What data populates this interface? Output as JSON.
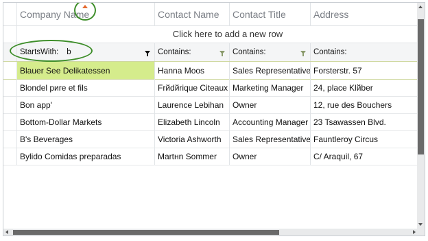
{
  "columns": [
    "Company Name",
    "Contact Name",
    "Contact Title",
    "Address"
  ],
  "new_row_text": "Click here to add a new row",
  "filter": [
    {
      "operator": "StartsWith:",
      "value": "b"
    },
    {
      "operator": "Contains:",
      "value": ""
    },
    {
      "operator": "Contains:",
      "value": ""
    },
    {
      "operator": "Contains:",
      "value": ""
    }
  ],
  "rows": [
    [
      "Blauer See Delikatessen",
      "Hanna Moos",
      "Sales Representative",
      "Forsterstr. 57"
    ],
    [
      "Blondel pиre et fils",
      "Frйdйrique Citeaux",
      "Marketing Manager",
      "24, place Klйber"
    ],
    [
      "Bon app'",
      "Laurence Lebihan",
      "Owner",
      "12, rue des Bouchers"
    ],
    [
      "Bottom-Dollar Markets",
      "Elizabeth Lincoln",
      "Accounting Manager",
      "23 Tsawassen Blvd."
    ],
    [
      "B's Beverages",
      "Victoria Ashworth",
      "Sales Representative",
      "Fauntleroy Circus"
    ],
    [
      "Bylido Comidas preparadas",
      "Martнn Sommer",
      "Owner",
      "C/ Araquil, 67"
    ]
  ],
  "colors": {
    "selected_cell": "#d5ec8c",
    "callout": "#3e8e2a",
    "sort_indicator": "#e56a2f"
  },
  "icons": {
    "sort": "sort-ascending-icon",
    "filter": "filter-funnel-icon"
  }
}
